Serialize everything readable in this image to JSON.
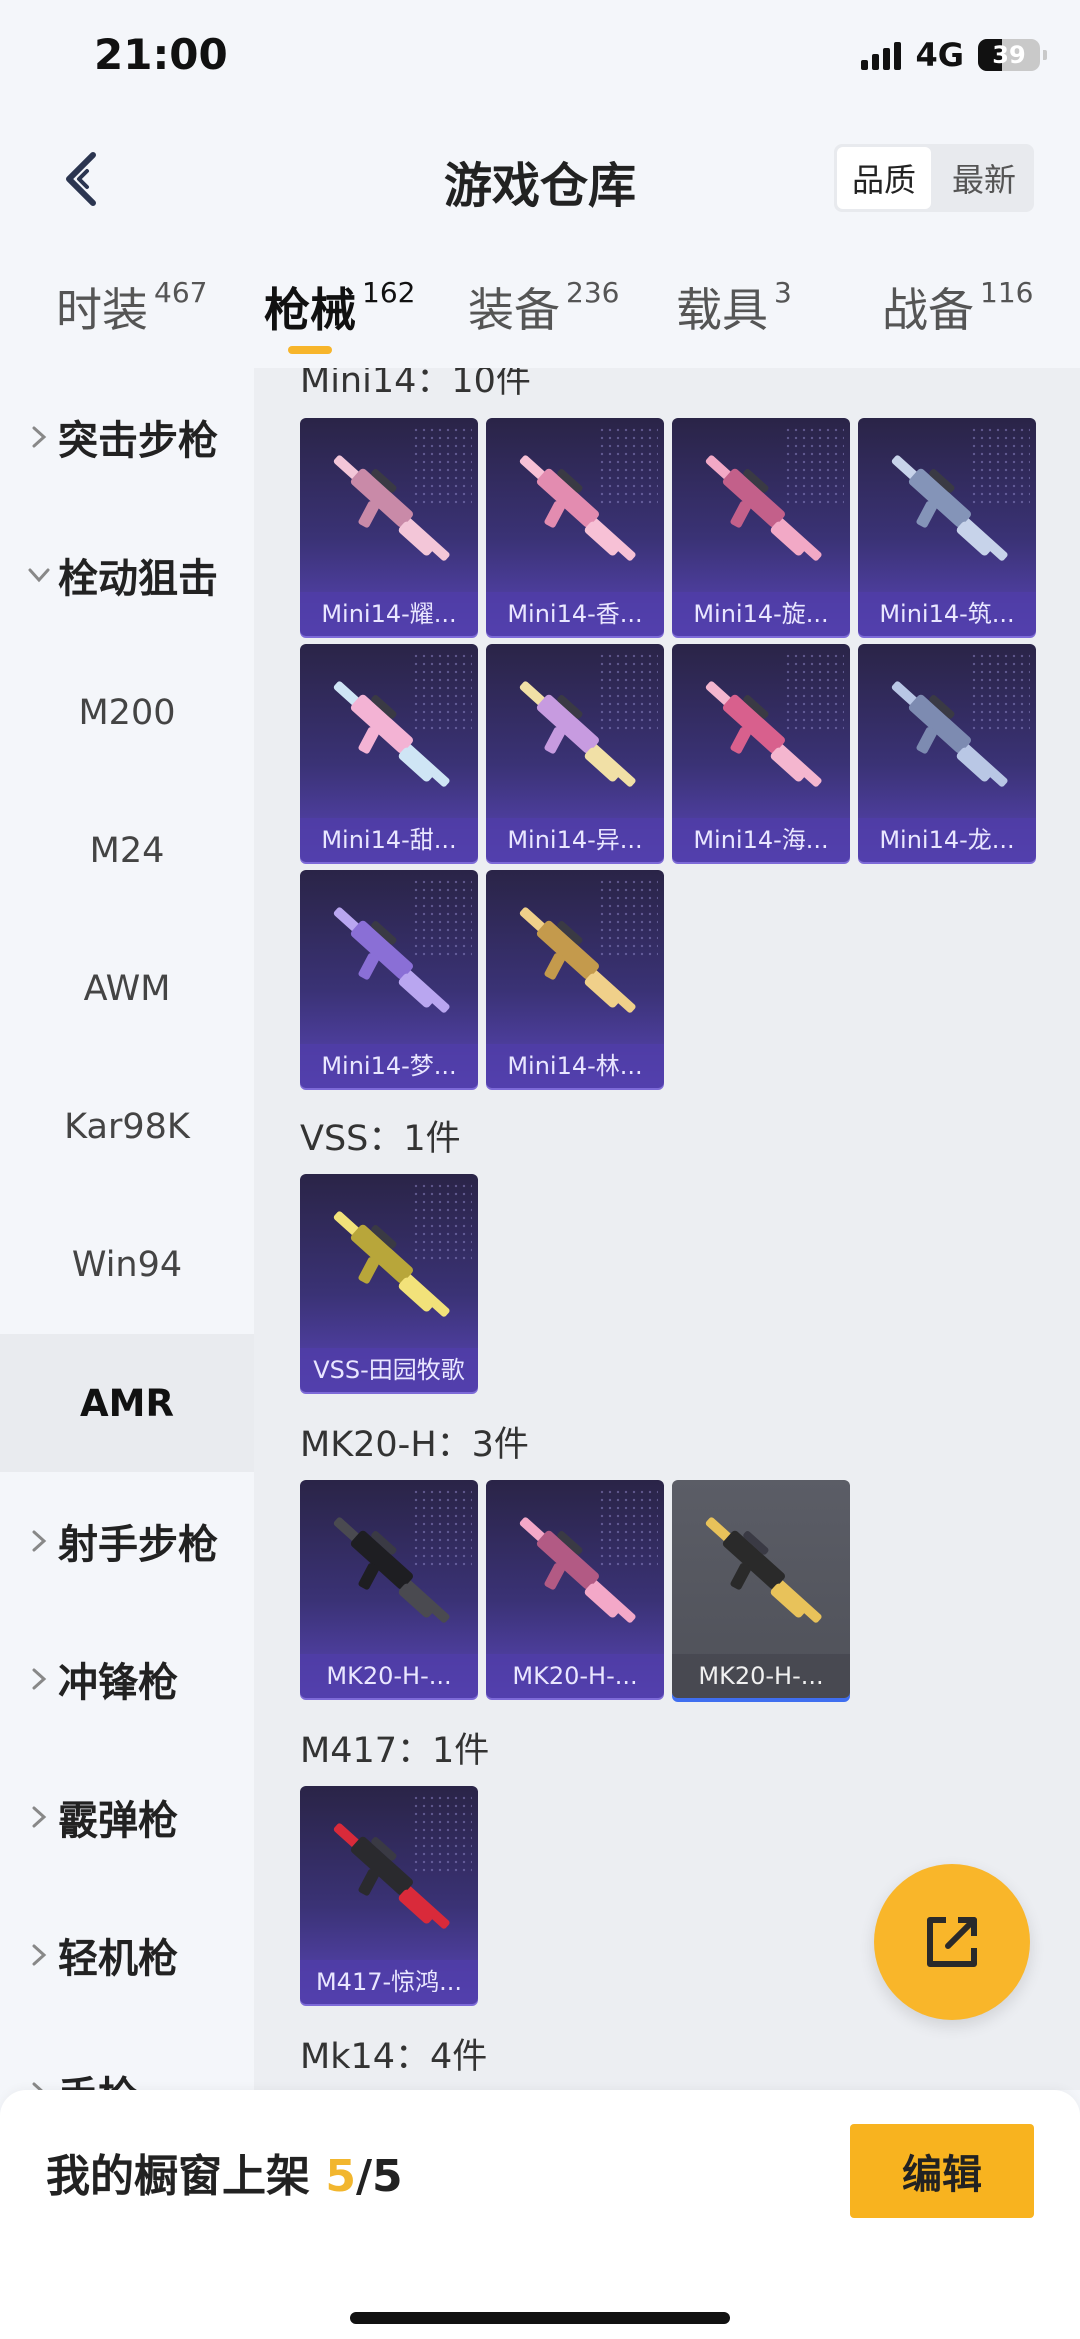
{
  "status": {
    "time": "21:00",
    "network": "4G",
    "battery": "39"
  },
  "header": {
    "title": "游戏仓库",
    "sort_options": [
      "品质",
      "最新"
    ]
  },
  "tabs": [
    {
      "label": "时装",
      "count": "467"
    },
    {
      "label": "枪械",
      "count": "162"
    },
    {
      "label": "装备",
      "count": "236"
    },
    {
      "label": "载具",
      "count": "3"
    },
    {
      "label": "战备",
      "count": "116"
    }
  ],
  "sidebar": {
    "categories": [
      "突击步枪",
      "栓动狙击",
      "射手步枪",
      "冲锋枪",
      "霰弹枪",
      "轻机枪",
      "手枪"
    ],
    "sub_items": [
      "M200",
      "M24",
      "AWM",
      "Kar98K",
      "Win94",
      "AMR"
    ]
  },
  "groups": [
    {
      "title": "Mini14：10件",
      "items": [
        "Mini14-耀...",
        "Mini14-香...",
        "Mini14-旋...",
        "Mini14-筑...",
        "Mini14-甜...",
        "Mini14-异...",
        "Mini14-海...",
        "Mini14-龙...",
        "Mini14-梦...",
        "Mini14-林..."
      ]
    },
    {
      "title": "VSS：1件",
      "items": [
        "VSS-田园牧歌"
      ]
    },
    {
      "title": "MK20-H：3件",
      "items": [
        "MK20-H-...",
        "MK20-H-...",
        "MK20-H-..."
      ]
    },
    {
      "title": "M417：1件",
      "items": [
        "M417-惊鸿..."
      ]
    },
    {
      "title": "Mk14：4件",
      "items": []
    }
  ],
  "bottom_bar": {
    "label": "我的橱窗上架 ",
    "count": "5",
    "total": "/5",
    "edit_label": "编辑"
  }
}
